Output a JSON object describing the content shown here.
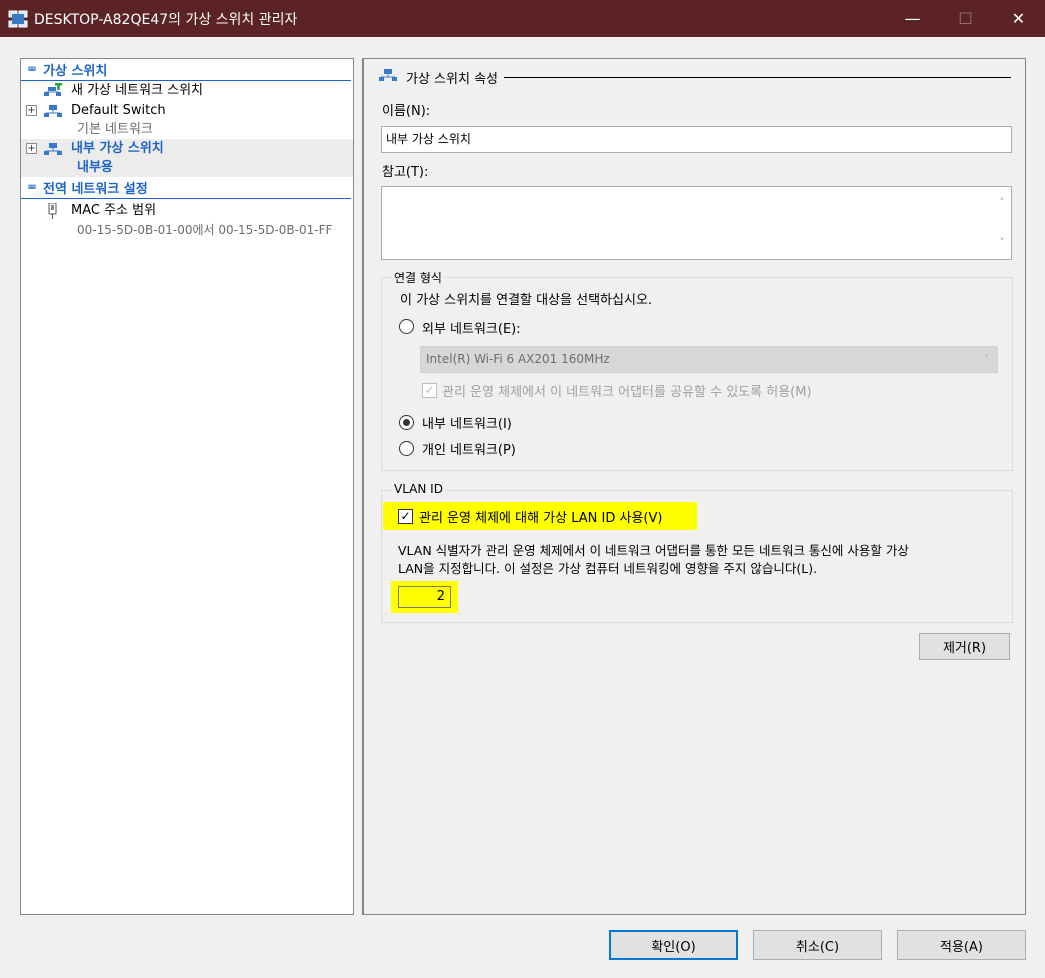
{
  "window": {
    "title": "DESKTOP-A82QE47의 가상 스위치 관리자",
    "controls": {
      "minimize": "—",
      "maximize": "☐",
      "close": "✕"
    }
  },
  "left": {
    "sections": [
      {
        "label": "가상 스위치"
      },
      {
        "label": "전역 네트워크 설정"
      }
    ],
    "items": {
      "new_switch": "새 가상 네트워크 스위치",
      "default_switch": {
        "name": "Default Switch",
        "sub": "기본 네트워크"
      },
      "internal_switch": {
        "name": "내부 가상 스위치",
        "sub": "내부용"
      },
      "mac_range": {
        "name": "MAC 주소 범위",
        "sub": "00-15-5D-0B-01-00에서 00-15-5D-0B-01-FF"
      }
    }
  },
  "right": {
    "group_title": "가상 스위치 속성",
    "name_label": "이름(N):",
    "name_value": "내부 가상 스위치",
    "notes_label": "참고(T):",
    "notes_value": "",
    "connection": {
      "legend": "연결 형식",
      "prompt": "이 가상 스위치를 연결할 대상을 선택하십시오.",
      "external_label": "외부 네트워크(E):",
      "adapter_value": "Intel(R) Wi-Fi 6 AX201 160MHz",
      "share_label": "관리 운영 체제에서 이 네트워크 어댑터를 공유할 수 있도록 허용(M)",
      "internal_label": "내부 네트워크(I)",
      "private_label": "개인 네트워크(P)"
    },
    "vlan": {
      "legend": "VLAN ID",
      "enable_label": "관리 운영 체제에 대해 가상 LAN ID 사용(V)",
      "description_line1": "VLAN 식별자가 관리 운영 체제에서 이 네트워크 어댑터를 통한 모든 네트워크 통신에 사용할 가상",
      "description_line2": "LAN을 지정합니다. 이 설정은 가상 컴퓨터 네트워킹에 영향을 주지 않습니다(L).",
      "id_value": "2"
    },
    "remove_button": "제거(R)"
  },
  "footer": {
    "ok": "확인(O)",
    "cancel": "취소(C)",
    "apply": "적용(A)"
  },
  "colors": {
    "titlebar": "#5b2323",
    "accent": "#1e64c8",
    "highlight": "#ffff00"
  }
}
